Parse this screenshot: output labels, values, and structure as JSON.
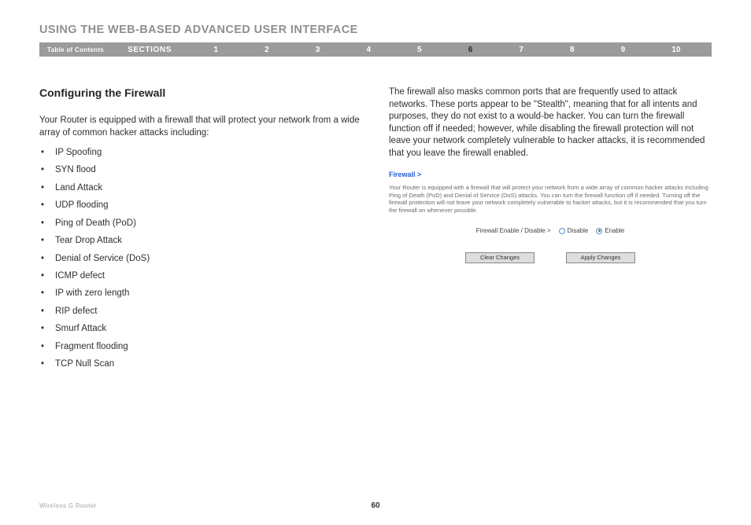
{
  "header": {
    "title": "USING THE WEB-BASED ADVANCED USER INTERFACE"
  },
  "navbar": {
    "toc": "Table of Contents",
    "sections_label": "SECTIONS",
    "items": [
      "1",
      "2",
      "3",
      "4",
      "5",
      "6",
      "7",
      "8",
      "9",
      "10"
    ],
    "active": "6"
  },
  "subheading": "Configuring the Firewall",
  "left": {
    "intro": "Your Router is equipped with a firewall that will protect your network from a wide array of common hacker attacks including:",
    "attacks": [
      "IP Spoofing",
      "SYN flood",
      "Land Attack",
      "UDP flooding",
      "Ping of Death (PoD)",
      "Tear Drop Attack",
      "Denial of Service (DoS)",
      "ICMP defect",
      "IP with zero length",
      "RIP defect",
      "Smurf Attack",
      "Fragment flooding",
      "TCP Null Scan"
    ]
  },
  "right": {
    "para": "The firewall also masks common ports that are frequently used to attack networks. These ports appear to be \"Stealth\", meaning that for all intents and purposes, they do not exist to a would-be hacker. You can turn the firewall function off if needed; however, while disabling the firewall protection will not leave your network completely vulnerable to hacker attacks, it is recommended that you leave the firewall enabled.",
    "panel": {
      "title": "Firewall >",
      "desc": "Your Router is equipped with a firewall that will protect your network from a wide array of common hacker attacks including Ping of Death (PoD) and Denial of Service (DoS) attacks. You can turn the firewall function off if needed. Turning off the firewall protection will not leave your network completely vulnerable to hacker attacks, but it is recommended that you turn the firewall on whenever possible.",
      "toggle_label": "Firewall Enable / Disable >",
      "options": {
        "disable": "Disable",
        "enable": "Enable"
      },
      "selected": "enable",
      "buttons": {
        "clear": "Clear Changes",
        "apply": "Apply Changes"
      }
    }
  },
  "footer": {
    "product": "Wireless G Router",
    "page": "60"
  }
}
